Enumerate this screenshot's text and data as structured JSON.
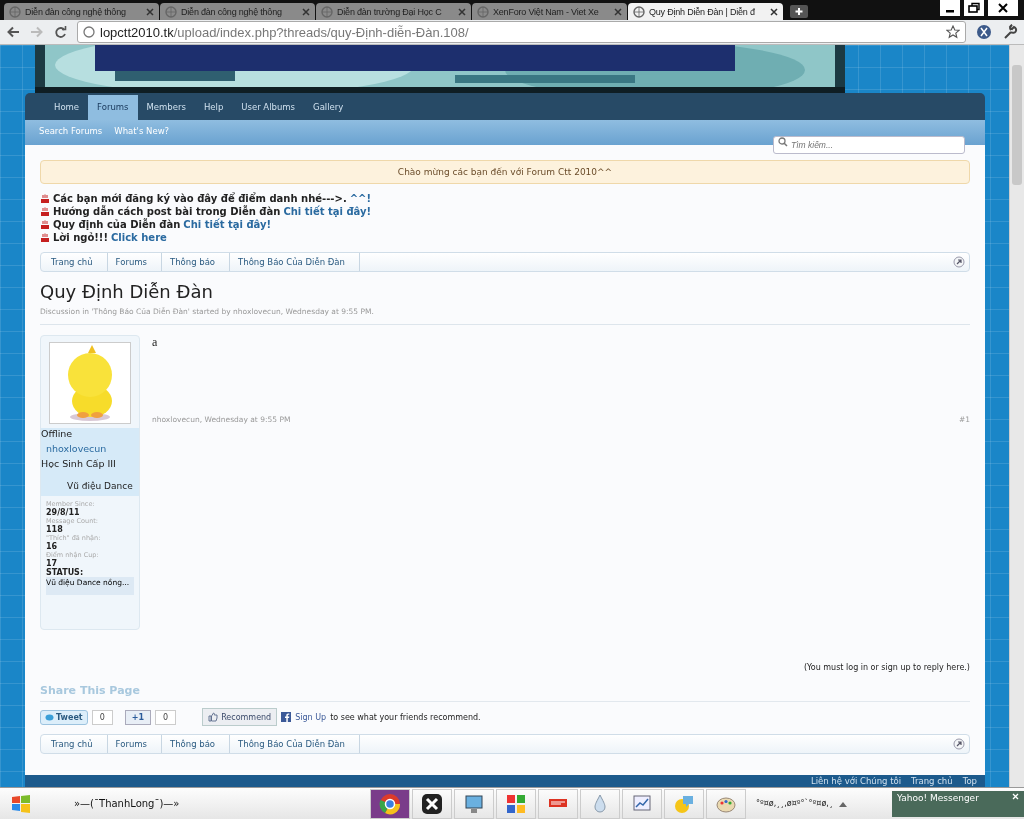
{
  "browser": {
    "tabs": [
      {
        "title": "Diễn đàn công nghệ thông",
        "selected": false
      },
      {
        "title": "Diễn đàn công nghệ thông",
        "selected": false
      },
      {
        "title": "Diễn đàn trường Đại Học C",
        "selected": false
      },
      {
        "title": "XenForo Việt Nam - Viet Xe",
        "selected": false
      },
      {
        "title": "Quy Định Diễn Đàn | Diễn đ",
        "selected": true
      }
    ],
    "address": {
      "host": "lopctt2010.tk",
      "path": "/upload/index.php?threads/quy-Định-diễn-Đàn.108/"
    }
  },
  "nav": {
    "tabs": [
      {
        "label": "Home",
        "selected": false
      },
      {
        "label": "Forums",
        "selected": true
      },
      {
        "label": "Members",
        "selected": false
      },
      {
        "label": "Help",
        "selected": false
      },
      {
        "label": "User Albums",
        "selected": false
      },
      {
        "label": "Gallery",
        "selected": false
      }
    ],
    "subnav": [
      "Search Forums",
      "What's New?"
    ],
    "search": {
      "placeholder": "Tìm kiếm..."
    }
  },
  "notice": "Chào mừng các bạn đến với Forum Ctt 2010^^",
  "announcements": [
    {
      "text": "Các bạn mới đăng ký vào đây để điểm danh nhé--->.",
      "link": "^^!"
    },
    {
      "text": "Hướng dẫn cách post bài trong Diễn đàn",
      "link": "Chi tiết tại đây!"
    },
    {
      "text": "Quy định của Diễn đàn",
      "link": "Chi tiết tại đây!"
    },
    {
      "text": "Lời ngỏ!!!",
      "link": "Click here"
    }
  ],
  "breadcrumb": [
    "Trang chủ",
    "Forums",
    "Thông báo",
    "Thông Báo Của Diễn Đàn"
  ],
  "thread": {
    "title": "Quy Định Diễn Đàn",
    "meta": "Discussion in 'Thông Báo Của Diễn Đàn' started by nhoxlovecun, Wednesday at 9:55 PM."
  },
  "post": {
    "user": {
      "online_status": "Offline",
      "name": "nhoxlovecun",
      "rank": "Học Sinh Cấp III",
      "custom": "Vũ điệu Dance",
      "stats": [
        {
          "label": "Member Since:",
          "value": "29/8/11"
        },
        {
          "label": "Message Count:",
          "value": "118"
        },
        {
          "label": "\"Thích\" đã nhận:",
          "value": "16"
        },
        {
          "label": "Điểm nhận Cup:",
          "value": "17"
        }
      ],
      "status_label": "STATUS:",
      "status_text": "Vũ điệu Dance nồng..."
    },
    "message": "a",
    "byline": "nhoxlovecun, Wednesday at 9:55 PM",
    "number": "#1"
  },
  "reply_note": "(You must log in or sign up to reply here.)",
  "share": {
    "title": "Share This Page",
    "tweet": {
      "label": "Tweet",
      "count": "0"
    },
    "plusone": {
      "label": "+1",
      "count": "0"
    },
    "recommend": "Recommend",
    "signup": "Sign Up",
    "signup_text": "to see what your friends recommend."
  },
  "breadcrumb_bottom": [
    "Trang chủ",
    "Forums",
    "Thông báo",
    "Thông Báo Của Diễn Đàn"
  ],
  "footer": {
    "links": [
      "Liên hệ với Chúng tôi",
      "Trang chủ",
      "Top"
    ]
  },
  "taskbar": {
    "user_label": "»—(¯ThanhLong¯)—»",
    "apps": [
      {
        "kind": "browser",
        "selected": true
      },
      {
        "kind": "x",
        "selected": false
      },
      {
        "kind": "monitor",
        "selected": false
      },
      {
        "kind": "tiles",
        "selected": false
      },
      {
        "kind": "flag",
        "selected": false
      },
      {
        "kind": "drop",
        "selected": false
      },
      {
        "kind": "chart",
        "selected": false
      },
      {
        "kind": "chat",
        "selected": false
      },
      {
        "kind": "palette",
        "selected": false
      }
    ],
    "tray_text": "°º¤ø,¸¸,ø¤º°`°º¤ø,¸",
    "popup": "Yahoo! Messenger"
  }
}
